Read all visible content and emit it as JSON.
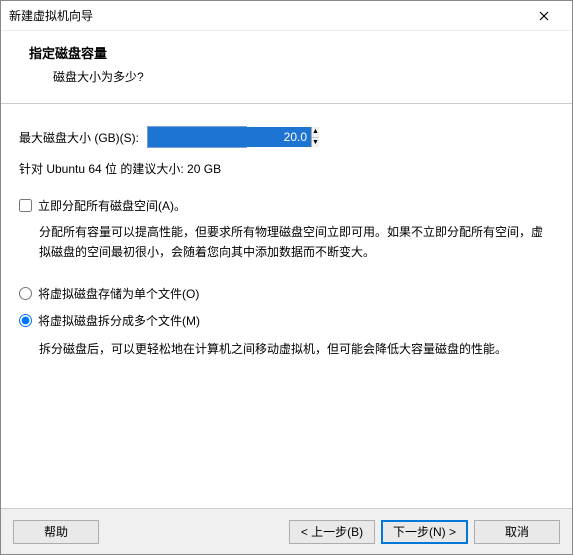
{
  "window": {
    "title": "新建虚拟机向导"
  },
  "header": {
    "title": "指定磁盘容量",
    "subtitle": "磁盘大小为多少?"
  },
  "disk": {
    "size_label": "最大磁盘大小 (GB)(S):",
    "size_value": "20.0",
    "recommendation": "针对 Ubuntu 64 位 的建议大小: 20 GB"
  },
  "allocate": {
    "label": "立即分配所有磁盘空间(A)。",
    "checked": false,
    "desc": "分配所有容量可以提高性能，但要求所有物理磁盘空间立即可用。如果不立即分配所有空间，虚拟磁盘的空间最初很小，会随着您向其中添加数据而不断变大。"
  },
  "split": {
    "single_label": "将虚拟磁盘存储为单个文件(O)",
    "multi_label": "将虚拟磁盘拆分成多个文件(M)",
    "selected": "multi",
    "multi_desc": "拆分磁盘后，可以更轻松地在计算机之间移动虚拟机，但可能会降低大容量磁盘的性能。"
  },
  "buttons": {
    "help": "帮助",
    "back": "< 上一步(B)",
    "next": "下一步(N) >",
    "cancel": "取消"
  }
}
